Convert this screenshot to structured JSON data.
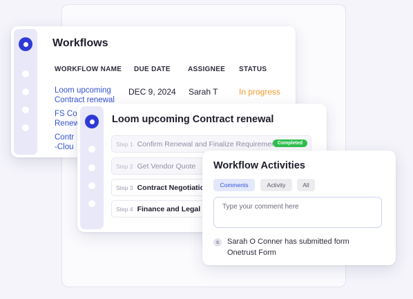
{
  "workflows": {
    "title": "Workflows",
    "columns": [
      "WORKFLOW NAME",
      "DUE DATE",
      "ASSIGNEE",
      "STATUS"
    ],
    "rows": [
      {
        "name_line1": "Loom upcoming",
        "name_line2": "Contract renewal",
        "due_date": "DEC 9, 2024",
        "assignee": "Sarah T",
        "status": "In progress"
      },
      {
        "name_line1": "FS Con",
        "name_line2": "Renew"
      },
      {
        "name_line1": "Contr",
        "name_line2": "-Clou"
      }
    ]
  },
  "workflow_detail": {
    "title": "Loom upcoming Contract renewal",
    "steps": [
      {
        "num": "Step 1",
        "label": "Confirm Renewal and Finalize Requirement",
        "badge": "Completed"
      },
      {
        "num": "Step 2",
        "label": "Get Vendor Quote"
      },
      {
        "num": "Step 3",
        "label": "Contract Negotiation"
      },
      {
        "num": "Step 4",
        "label": "Finance and Legal"
      }
    ]
  },
  "activities": {
    "title": "Workflow Activities",
    "tabs": [
      "Comments",
      "Activity",
      "All"
    ],
    "comment_placeholder": "Type your comment here",
    "avatar_initial": "S",
    "entry_line1": "Sarah O Conner has submitted form",
    "entry_line2": "Onetrust Form"
  },
  "colors": {
    "accent": "#2f3ad6",
    "link": "#3553d8",
    "status_in_progress": "#f39a2c",
    "badge_completed": "#2fbf4e"
  }
}
